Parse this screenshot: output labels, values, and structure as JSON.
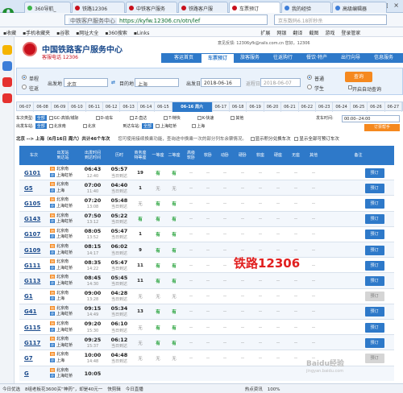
{
  "browser": {
    "tabs": [
      {
        "label": "360导航_",
        "color": "#3db54a"
      },
      {
        "label": "铁路12306",
        "color": "#c8101c"
      },
      {
        "label": "中铁客户服务",
        "color": "#c8101c"
      },
      {
        "label": "铁路客户服",
        "color": "#c8101c"
      },
      {
        "label": "车票预订",
        "color": "#c8101c"
      },
      {
        "label": "我的经验",
        "color": "#3d7ed8"
      },
      {
        "label": "高级编辑器",
        "color": "#3d7ed8"
      }
    ],
    "url_prefix": "中铁客户服务中心",
    "url": "https://kyfw.12306.cn/otn/lef",
    "search_placeholder": "京东数码6.18折秒杀",
    "bookmarks": [
      "收藏",
      "手机收藏夹",
      "谷歌",
      "网址大全",
      "360搜索",
      "Links"
    ],
    "toolbar": [
      "扩展",
      "网银",
      "翻译",
      "截图",
      "游戏",
      "登录管家"
    ]
  },
  "site": {
    "title": "中国铁路客户服务中心",
    "subtitle": "客服电话 12306",
    "user_info": "意见反馈: 12306yfk@rails.com.cn   您好，12306",
    "nav": [
      "客运首页",
      "车票预订",
      "旅客服务",
      "往返购行",
      "餐饮·特产",
      "出行向导",
      "信息服务"
    ],
    "nav_active": 1
  },
  "query": {
    "trip_oneway": "单程",
    "trip_return": "往返",
    "from_label": "出发地",
    "from_value": "北京",
    "to_label": "目的地",
    "to_value": "上海",
    "date_label": "出发日",
    "date_value": "2018-06-16",
    "return_label": "返程日",
    "return_value": "2018-06-07",
    "ticket_normal": "普通",
    "ticket_student": "学生",
    "search_button": "查询",
    "auto_query": "开启自动查询"
  },
  "dates": [
    "06-07",
    "06-08",
    "06-09",
    "06-10",
    "06-11",
    "06-12",
    "06-13",
    "06-14",
    "06-15",
    "06-16 周六",
    "06-17",
    "06-18",
    "06-19",
    "06-20",
    "06-21",
    "06-22",
    "06-23",
    "06-24",
    "06-25",
    "06-26",
    "06-27"
  ],
  "date_selected": 9,
  "filters": {
    "type_label": "车次类型:",
    "all": "全部",
    "types": [
      "GC-高铁/城际",
      "D-动车",
      "Z-直达",
      "T-特快",
      "K-快速",
      "其他"
    ],
    "from_station_label": "出发车站:",
    "from_stations": [
      "北京南",
      "北京"
    ],
    "to_station_label": "到达车站:",
    "to_stations": [
      "上海虹桥",
      "上海"
    ],
    "time_label": "发车时间:",
    "time_value": "00:00--24:00",
    "order_button": "订票帮手"
  },
  "summary": {
    "route": "北京 --> 上海（6月16日 周六）共计46个车次",
    "tip": "您可使用接续换乘功能，查询途中换乘一次的部分列车余票情况。",
    "opt1": "显示积分兑换车次",
    "opt2": "显示全部可预订车次"
  },
  "table": {
    "headers": [
      "车次",
      "出发站\n到达站",
      "出发时间\n到达时间",
      "历时",
      "商务座\n特等座",
      "一等座",
      "二等座",
      "高级\n软卧",
      "软卧",
      "动卧",
      "硬卧",
      "软座",
      "硬座",
      "无座",
      "其他",
      "备注"
    ],
    "book_label": "预订",
    "rows": [
      {
        "no": "G101",
        "from": "北京南",
        "to": "上海虹桥",
        "dep": "06:43",
        "arr": "12:40",
        "dur": "05:57",
        "day": "当日到达",
        "sw": "19",
        "yd": "有",
        "ed": "有",
        "book": true
      },
      {
        "no": "G5",
        "from": "北京南",
        "to": "上海",
        "dep": "07:00",
        "arr": "11:40",
        "dur": "04:40",
        "day": "当日到达",
        "sw": "1",
        "yd": "无",
        "ed": "无",
        "book": true
      },
      {
        "no": "G105",
        "from": "北京南",
        "to": "上海虹桥",
        "dep": "07:20",
        "arr": "13:08",
        "dur": "05:48",
        "day": "当日到达",
        "sw": "无",
        "yd": "有",
        "ed": "有",
        "book": true
      },
      {
        "no": "G143",
        "from": "北京南",
        "to": "上海虹桥",
        "dep": "07:50",
        "arr": "13:12",
        "dur": "05:22",
        "day": "当日到达",
        "sw": "有",
        "yd": "有",
        "ed": "有",
        "book": true
      },
      {
        "no": "G107",
        "from": "北京南",
        "to": "上海虹桥",
        "dep": "08:05",
        "arr": "13:52",
        "dur": "05:47",
        "day": "当日到达",
        "sw": "1",
        "yd": "有",
        "ed": "有",
        "book": true
      },
      {
        "no": "G109",
        "from": "北京南",
        "to": "上海虹桥",
        "dep": "08:15",
        "arr": "14:17",
        "dur": "06:02",
        "day": "当日到达",
        "sw": "9",
        "yd": "有",
        "ed": "有",
        "book": true
      },
      {
        "no": "G111",
        "from": "北京南",
        "to": "上海虹桥",
        "dep": "08:35",
        "arr": "14:22",
        "dur": "05:47",
        "day": "当日到达",
        "sw": "11",
        "yd": "有",
        "ed": "有",
        "book": true
      },
      {
        "no": "G113",
        "from": "北京南",
        "to": "上海虹桥",
        "dep": "08:45",
        "arr": "14:30",
        "dur": "05:45",
        "day": "当日到达",
        "sw": "11",
        "yd": "有",
        "ed": "有",
        "book": true
      },
      {
        "no": "G1",
        "from": "北京南",
        "to": "上海",
        "dep": "09:00",
        "arr": "13:28",
        "dur": "04:28",
        "day": "当日到达",
        "sw": "无",
        "yd": "无",
        "ed": "无",
        "book": false
      },
      {
        "no": "G41",
        "from": "北京南",
        "to": "上海虹桥",
        "dep": "09:15",
        "arr": "14:49",
        "dur": "05:34",
        "day": "当日到达",
        "sw": "13",
        "yd": "有",
        "ed": "有",
        "book": true
      },
      {
        "no": "G115",
        "from": "北京南",
        "to": "上海虹桥",
        "dep": "09:20",
        "arr": "15:30",
        "dur": "06:10",
        "day": "当日到达",
        "sw": "无",
        "yd": "有",
        "ed": "有",
        "book": true
      },
      {
        "no": "G117",
        "from": "北京南",
        "to": "上海虹桥",
        "dep": "09:25",
        "arr": "15:37",
        "dur": "06:12",
        "day": "当日到达",
        "sw": "无",
        "yd": "有",
        "ed": "有",
        "book": true
      },
      {
        "no": "G7",
        "from": "北京南",
        "to": "上海",
        "dep": "10:00",
        "arr": "14:48",
        "dur": "04:48",
        "day": "当日到达",
        "sw": "无",
        "yd": "无",
        "ed": "无",
        "book": false
      },
      {
        "no": "G",
        "from": "北京南",
        "to": "上海虹桥",
        "dep": "10:05",
        "arr": "",
        "dur": "",
        "day": "",
        "sw": "",
        "yd": "",
        "ed": "",
        "book": false
      }
    ]
  },
  "watermark": "铁路12306",
  "jingyan": "Baidu经验",
  "jingyan_sub": "jingyan.baidu.com",
  "statusbar": [
    "今日优选",
    "8组老板花3600买“神药”，却是40元一",
    "快剪辑",
    "今日直播",
    "热点资讯",
    "100%"
  ]
}
